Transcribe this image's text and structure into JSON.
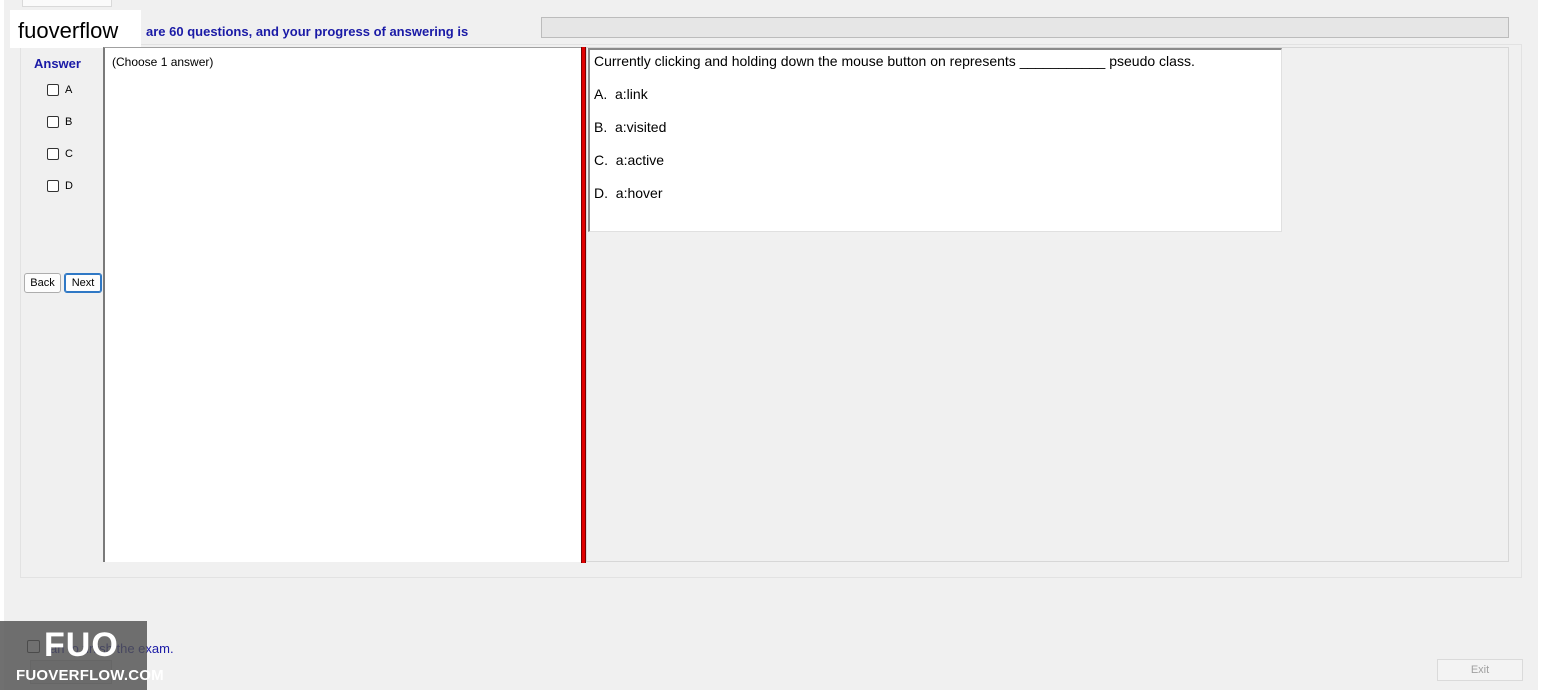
{
  "header": {
    "progress_text": "are 60 questions, and your progress of answering is",
    "progress_value": 0
  },
  "watermark": {
    "top_text": "fuoverflow",
    "logo_text": "FUO",
    "domain_text": "FUOVERFLOW.COM"
  },
  "answer_panel": {
    "title": "Answer",
    "options": [
      "A",
      "B",
      "C",
      "D"
    ],
    "back_label": "Back",
    "next_label": "Next"
  },
  "left_box": {
    "instruction": "(Choose 1 answer)"
  },
  "question": {
    "text": "Currently clicking and holding down the mouse button on represents ___________ pseudo class.",
    "choices": [
      "A.  a:link",
      "B.  a:visited",
      "C.  a:active",
      "D.  a:hover"
    ]
  },
  "footer": {
    "finish_label": "an to finish the exam.",
    "exit_label": "Exit"
  },
  "colors": {
    "accent_text": "#1a1aa6",
    "splitter": "#e00000"
  }
}
